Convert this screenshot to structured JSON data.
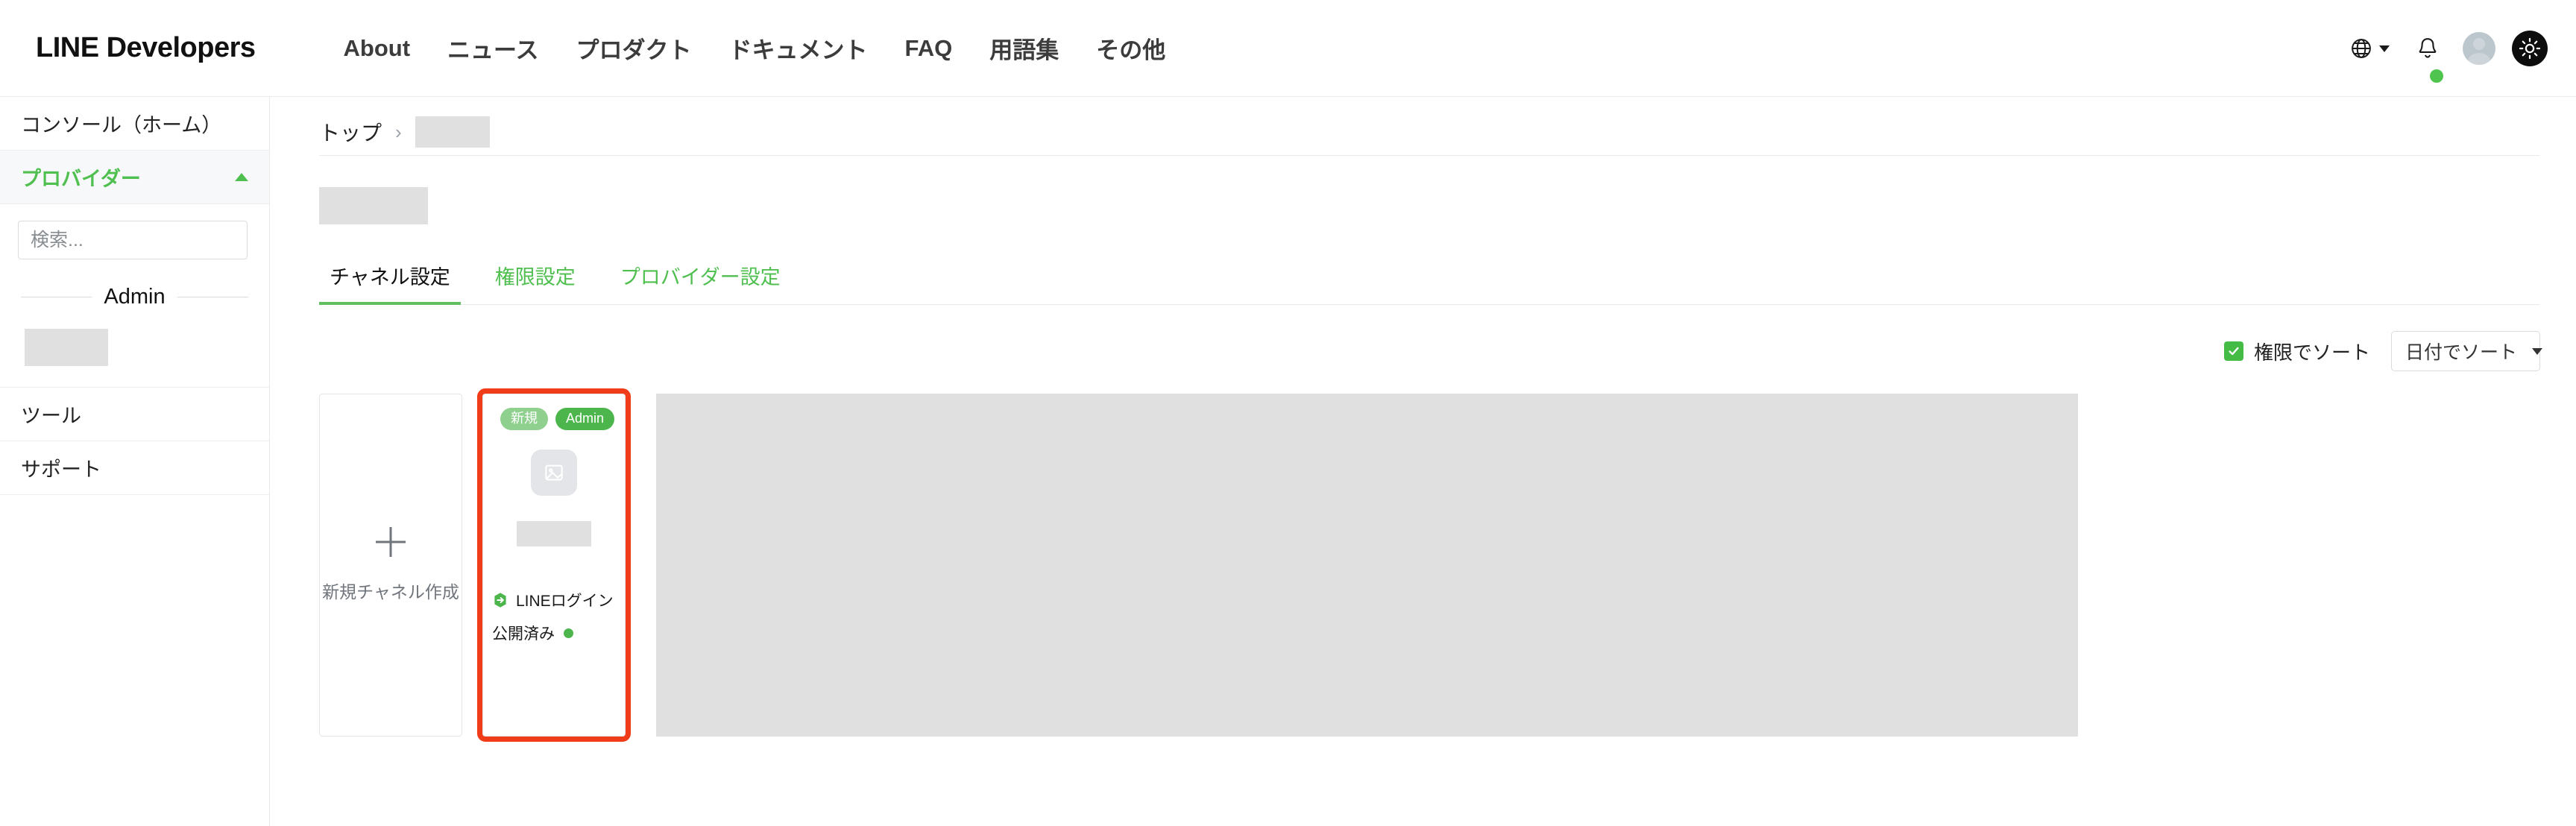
{
  "header": {
    "brand": "LINE Developers",
    "nav": [
      {
        "label": "About"
      },
      {
        "label": "ニュース"
      },
      {
        "label": "プロダクト"
      },
      {
        "label": "ドキュメント"
      },
      {
        "label": "FAQ"
      },
      {
        "label": "用語集"
      },
      {
        "label": "その他"
      }
    ],
    "icons": {
      "language": "globe-icon",
      "language_caret": "chevron-down-icon",
      "notifications": "bell-icon",
      "notification_badge": "green-dot",
      "account": "avatar",
      "theme_toggle": "sun-icon"
    }
  },
  "sidebar": {
    "console_home": "コンソール（ホーム）",
    "provider": {
      "label": "プロバイダー",
      "collapse_icon": "chevron-up-icon",
      "search_placeholder": "検索...",
      "search_value": "",
      "group_label": "Admin",
      "redacted_item": ""
    },
    "tools": "ツール",
    "support": "サポート"
  },
  "main": {
    "breadcrumb": {
      "root": "トップ",
      "separator": "›",
      "current_redacted": ""
    },
    "page_title_redacted": "",
    "tabs": [
      {
        "label": "チャネル設定",
        "active": true
      },
      {
        "label": "権限設定",
        "active": false
      },
      {
        "label": "プロバイダー設定",
        "active": false
      }
    ],
    "toolbar": {
      "sort_by_role_label": "権限でソート",
      "sort_by_role_checked": true,
      "sort_select_value": "日付でソート",
      "sort_select_caret": "chevron-down-icon"
    },
    "cards": {
      "new_channel": {
        "icon": "plus-icon",
        "label": "新規チャネル作成"
      },
      "channel": {
        "badge_new": "新規",
        "badge_role": "Admin",
        "thumbnail_icon": "image-placeholder-icon",
        "name_redacted": "",
        "type_icon": "line-login-icon",
        "type_label": "LINEログイン",
        "status_label": "公開済み",
        "status_dot": "green-dot",
        "highlighted": true
      },
      "redacted_block": ""
    }
  },
  "colors": {
    "brand_green": "#4fbf4f",
    "badge_new": "#8fd08f",
    "badge_admin": "#4cb64c",
    "status_green": "#4cb64c",
    "highlight_red": "#f03c18",
    "redaction_gray": "#e0e0e0",
    "text_dark": "#111111"
  }
}
